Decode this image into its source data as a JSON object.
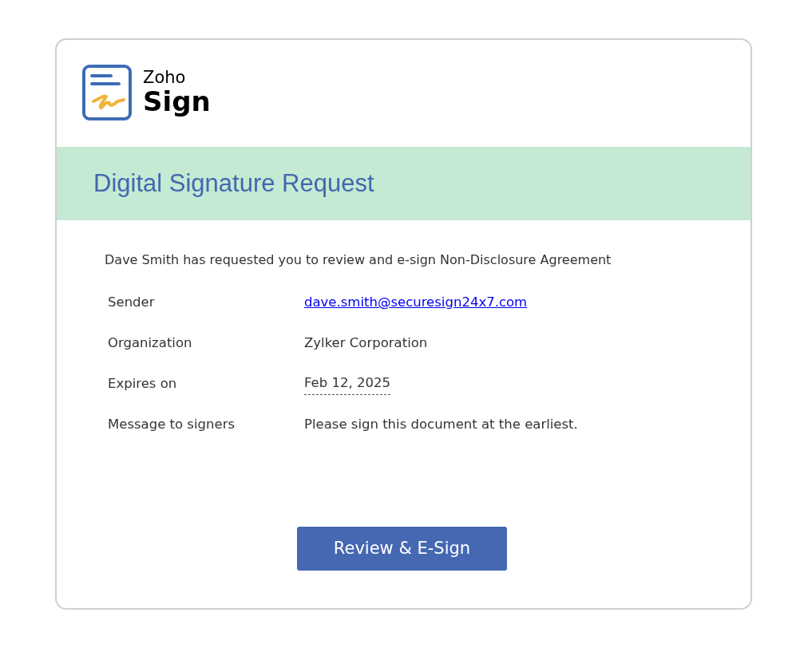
{
  "logo": {
    "line1": "Zoho",
    "line2": "Sign"
  },
  "banner": {
    "title": "Digital Signature Request"
  },
  "intro": "Dave Smith has requested you to review and e-sign Non-Disclosure Agreement",
  "details": [
    {
      "label": "Sender",
      "value": "dave.smith@securesign24x7.com",
      "kind": "link"
    },
    {
      "label": "Organization",
      "value": "Zylker Corporation",
      "kind": "text"
    },
    {
      "label": "Expires on",
      "value": "Feb 12, 2025",
      "kind": "date"
    },
    {
      "label": "Message to signers",
      "value": "Please sign this document at the earliest.",
      "kind": "text"
    }
  ],
  "button": "Review & E-Sign"
}
